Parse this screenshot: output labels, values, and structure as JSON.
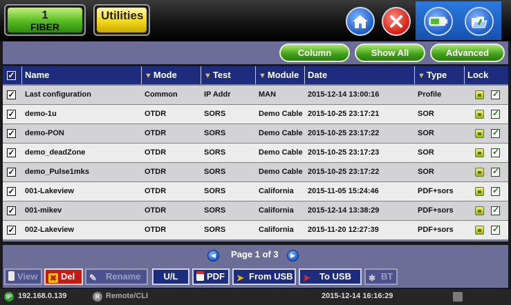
{
  "tabs": {
    "fiber_number": "1",
    "fiber_label": "FIBER",
    "utilities_label": "Utilities"
  },
  "actions": {
    "column": "Column",
    "show_all": "Show All",
    "advanced": "Advanced"
  },
  "columns": {
    "name": "Name",
    "mode": "Mode",
    "test": "Test",
    "module": "Module",
    "date": "Date",
    "type": "Type",
    "lock": "Lock"
  },
  "rows": [
    {
      "name": "Last configuration",
      "mode": "Common",
      "test": "IP Addr",
      "module": "MAN",
      "date": "2015-12-14 13:00:16",
      "type": "Profile"
    },
    {
      "name": "demo-1u",
      "mode": "OTDR",
      "test": "SORS",
      "module": "Demo Cable",
      "date": "2015-10-25 23:17:21",
      "type": "SOR"
    },
    {
      "name": "demo-PON",
      "mode": "OTDR",
      "test": "SORS",
      "module": "Demo Cable",
      "date": "2015-10-25 23:17:22",
      "type": "SOR"
    },
    {
      "name": "demo_deadZone",
      "mode": "OTDR",
      "test": "SORS",
      "module": "Demo Cable",
      "date": "2015-10-25 23:17:23",
      "type": "SOR"
    },
    {
      "name": "demo_Pulse1mks",
      "mode": "OTDR",
      "test": "SORS",
      "module": "Demo Cable",
      "date": "2015-10-25 23:17:22",
      "type": "SOR"
    },
    {
      "name": "001-Lakeview",
      "mode": "OTDR",
      "test": "SORS",
      "module": "California",
      "date": "2015-11-05 15:24:46",
      "type": "PDF+sors"
    },
    {
      "name": "001-mikev",
      "mode": "OTDR",
      "test": "SORS",
      "module": "California",
      "date": "2015-12-14 13:38:29",
      "type": "PDF+sors"
    },
    {
      "name": "002-Lakeview",
      "mode": "OTDR",
      "test": "SORS",
      "module": "California",
      "date": "2015-11-20 12:27:39",
      "type": "PDF+sors"
    }
  ],
  "pager": {
    "text": "Page 1 of 3"
  },
  "toolbar": {
    "view": "View",
    "del": "Del",
    "rename": "Rename",
    "ul": "U/L",
    "pdf": "PDF",
    "from_usb": "From USB",
    "to_usb": "To USB",
    "bt": "BT"
  },
  "status": {
    "ip_badge": "IP",
    "ip": "192.168.0.139",
    "remote_badge": "R",
    "remote": "Remote/CLI",
    "datetime": "2015-12-14  16:16:29"
  },
  "colors": {
    "header": "#1d2c7d",
    "accent_green": "#3f9f1a",
    "band": "#6c6e98",
    "delete_red": "#c41c12"
  }
}
